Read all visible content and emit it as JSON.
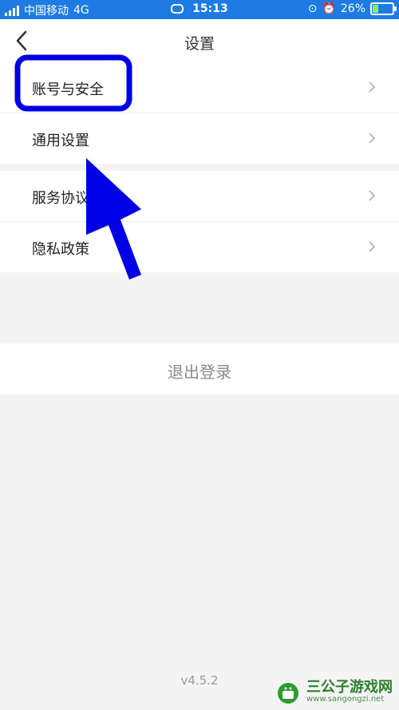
{
  "status_bar": {
    "carrier": "中国移动",
    "network": "4G",
    "time": "15:13",
    "battery": "26%",
    "battery_level": 0.26
  },
  "header": {
    "title": "设置",
    "back_icon": "chevron-left-icon"
  },
  "settings": {
    "group1": [
      {
        "label": "账号与安全"
      },
      {
        "label": "通用设置"
      }
    ],
    "group2": [
      {
        "label": "服务协议"
      },
      {
        "label": "隐私政策"
      }
    ]
  },
  "logout_label": "退出登录",
  "version": "v4.5.2",
  "annotation": {
    "color": "#0000e6"
  },
  "watermark": {
    "title": "三公子游戏网",
    "url": "www.sangongzi.net"
  }
}
